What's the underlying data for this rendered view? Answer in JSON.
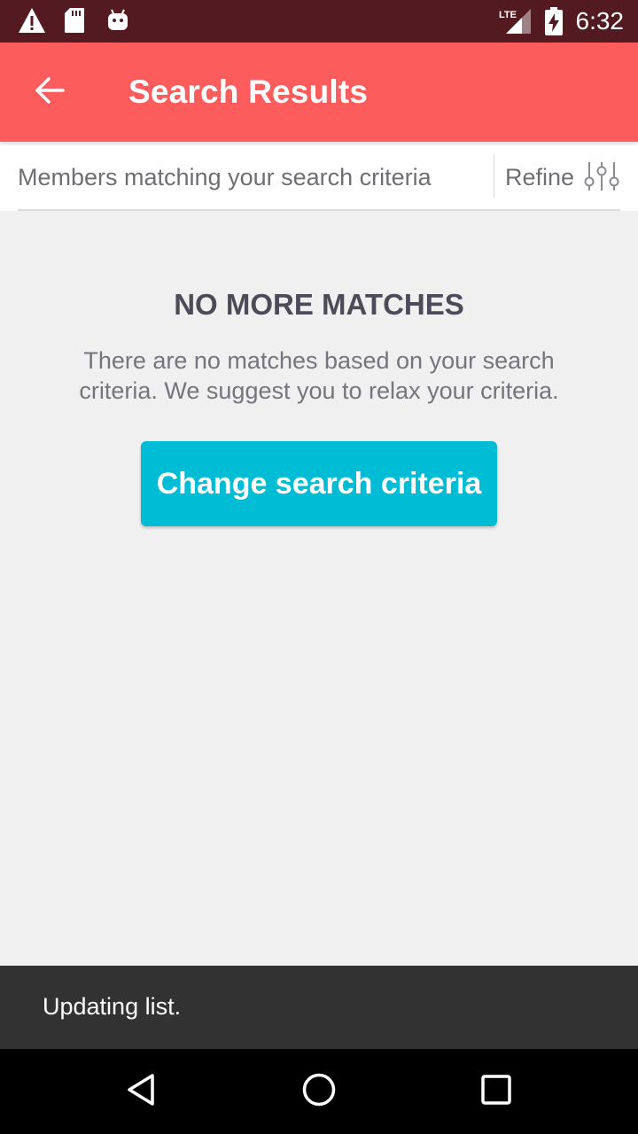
{
  "status_bar": {
    "time": "6:32",
    "icons": [
      "warning-icon",
      "sd-card-icon",
      "android-icon",
      "lte-signal-icon",
      "battery-charging-icon"
    ],
    "network_label": "LTE"
  },
  "app_bar": {
    "title": "Search Results",
    "back_icon": "arrow-back-icon"
  },
  "sub_header": {
    "members_text": "Members matching your search criteria",
    "refine_label": "Refine",
    "refine_icon": "sliders-icon"
  },
  "empty_state": {
    "title": "NO MORE MATCHES",
    "message": "There are no matches based on your search criteria. We suggest you to relax your criteria.",
    "button_label": "Change search criteria"
  },
  "snackbar": {
    "text": "Updating list."
  },
  "nav_bar": {
    "icons": [
      "back-triangle-icon",
      "home-circle-icon",
      "recents-square-icon"
    ]
  },
  "colors": {
    "status_bar": "#541a22",
    "app_bar": "#fd5c5c",
    "accent_button": "#00bcd4",
    "background": "#f0f0f0",
    "snackbar": "#323232",
    "nav_bar": "#000000"
  }
}
